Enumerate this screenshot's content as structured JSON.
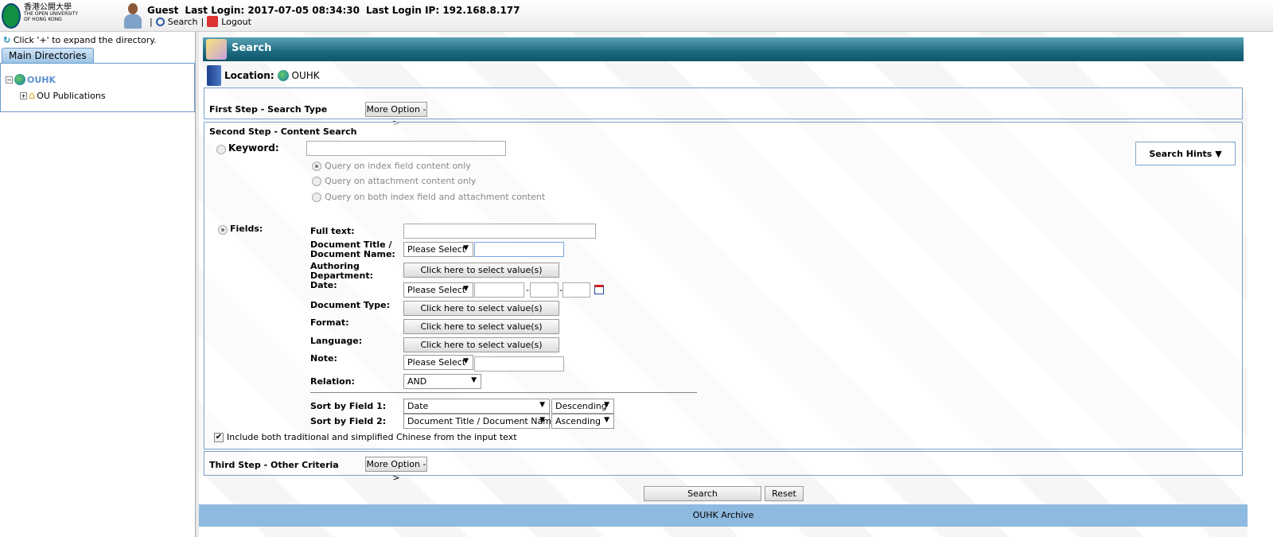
{
  "header": {
    "logo_chinese": "香港公開大學",
    "logo_english_1": "THE OPEN UNIVERSITY",
    "logo_english_2": "OF HONG KONG",
    "user": "Guest",
    "last_login": "Last Login: 2017-07-05 08:34:30",
    "last_login_ip": "Last Login IP: 192.168.8.177",
    "search_link": "Search",
    "logout_link": "Logout",
    "sep": "|"
  },
  "sidebar": {
    "hint": "Click '+' to expand the directory.",
    "tab": "Main Directories",
    "tree": [
      {
        "label": "OUHK",
        "toggle": "−"
      },
      {
        "label": "OU Publications",
        "toggle": "+"
      }
    ]
  },
  "main": {
    "title": "Search",
    "location_label": "Location:",
    "location_value": "OUHK",
    "step1": {
      "title": "First Step - Search Type",
      "more_option": "More Option ->"
    },
    "step2": {
      "title": "Second Step - Content Search",
      "search_hints": "Search Hints",
      "keyword_label": "Keyword:",
      "keyword_value": "",
      "keyword_options": [
        "Query on index field content only",
        "Query on attachment content only",
        "Query on both index field and attachment content"
      ],
      "fields_label": "Fields:",
      "full_text": "Full text:",
      "doc_title": "Document Title / Document Name:",
      "authoring": "Authoring Department:",
      "date": "Date:",
      "doc_type": "Document Type:",
      "format": "Format:",
      "language": "Language:",
      "note": "Note:",
      "relation": "Relation:",
      "please_select": "Please Select",
      "click_select": "Click here to select value(s)",
      "relation_value": "AND",
      "date_sep": "-",
      "sort1_label": "Sort by Field 1:",
      "sort1_field": "Date",
      "sort1_order": "Descending",
      "sort2_label": "Sort by Field 2:",
      "sort2_field": "Document Title / Document Name",
      "sort2_order": "Ascending",
      "chinese_checkbox": "Include both traditional and simplified Chinese from the input text",
      "chinese_checked": true
    },
    "step3": {
      "title": "Third Step - Other Criteria",
      "more_option": "More Option ->"
    },
    "search_button": "Search",
    "reset_button": "Reset"
  },
  "footer": "OUHK Archive"
}
